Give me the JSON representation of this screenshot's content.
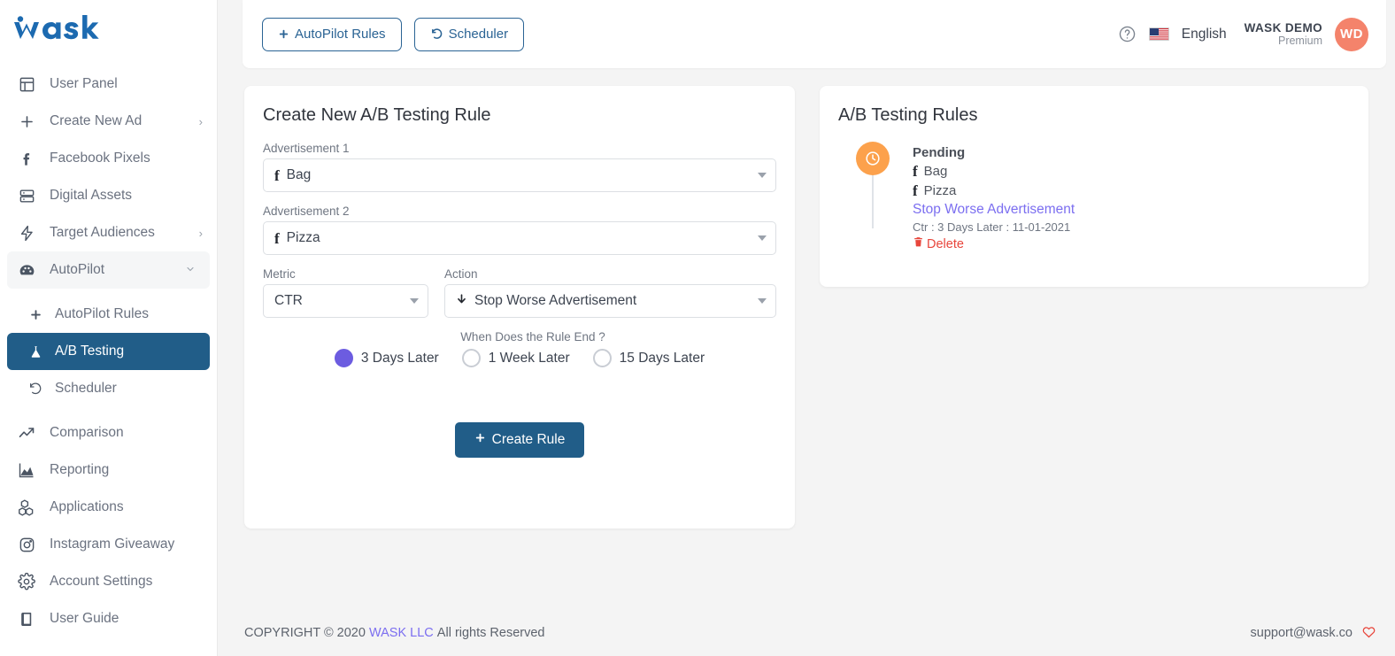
{
  "brand": {
    "logo_text": "wask",
    "logo_color": "#1c6ab0"
  },
  "sidebar": {
    "items": [
      {
        "label": "User Panel",
        "icon": "layout-icon",
        "chevron": ""
      },
      {
        "label": "Create New Ad",
        "icon": "plus-icon",
        "chevron": "›"
      },
      {
        "label": "Facebook Pixels",
        "icon": "facebook-f-icon",
        "chevron": ""
      },
      {
        "label": "Digital Assets",
        "icon": "server-icon",
        "chevron": ""
      },
      {
        "label": "Target Audiences",
        "icon": "bolt-icon",
        "chevron": "›"
      },
      {
        "label": "AutoPilot",
        "icon": "speedometer-icon",
        "chevron": "⌄"
      },
      {
        "label": "AutoPilot Rules",
        "icon": "plus-icon",
        "chevron": ""
      },
      {
        "label": "A/B Testing",
        "icon": "flask-icon",
        "chevron": ""
      },
      {
        "label": "Scheduler",
        "icon": "history-icon",
        "chevron": ""
      },
      {
        "label": "Comparison",
        "icon": "trend-up-icon",
        "chevron": ""
      },
      {
        "label": "Reporting",
        "icon": "area-chart-icon",
        "chevron": ""
      },
      {
        "label": "Applications",
        "icon": "cubes-icon",
        "chevron": ""
      },
      {
        "label": "Instagram Giveaway",
        "icon": "instagram-icon",
        "chevron": ""
      },
      {
        "label": "Account Settings",
        "icon": "gear-icon",
        "chevron": ""
      },
      {
        "label": "User Guide",
        "icon": "book-icon",
        "chevron": ""
      }
    ],
    "active_label": "A/B Testing",
    "active_color": "#215d88"
  },
  "topbar": {
    "autopilot_rules_label": "AutoPilot Rules",
    "scheduler_label": "Scheduler",
    "help_icon": "question-circle-icon",
    "language": "English",
    "account_name": "WASK DEMO",
    "account_plan": "Premium",
    "avatar_initials": "WD",
    "avatar_color": "#f4836b"
  },
  "create_rule_card": {
    "title": "Create New A/B Testing Rule",
    "ad1": {
      "label": "Advertisement 1",
      "value": "Bag"
    },
    "ad2": {
      "label": "Advertisement 2",
      "value": "Pizza"
    },
    "metric": {
      "label": "Metric",
      "value": "CTR"
    },
    "action": {
      "label": "Action",
      "value": "Stop Worse Advertisement"
    },
    "rule_end_question": "When Does the Rule End ?",
    "rule_end_options": [
      {
        "label": "3 Days Later",
        "selected": true
      },
      {
        "label": "1 Week Later",
        "selected": false
      },
      {
        "label": "15 Days Later",
        "selected": false
      }
    ],
    "selected_radio_color": "#6c5ce0",
    "submit_label": "Create Rule"
  },
  "rules_card": {
    "title": "A/B Testing Rules",
    "rules": [
      {
        "status": "Pending",
        "status_color": "#fca14c",
        "ad1": "Bag",
        "ad2": "Pizza",
        "action": "Stop Worse Advertisement",
        "meta": "Ctr : 3 Days Later : 11-01-2021",
        "delete_label": "Delete"
      }
    ]
  },
  "footer": {
    "copyright_prefix": "COPYRIGHT © 2020",
    "company": "WASK LLC",
    "copyright_suffix": "All rights Reserved",
    "support_email": "support@wask.co"
  }
}
